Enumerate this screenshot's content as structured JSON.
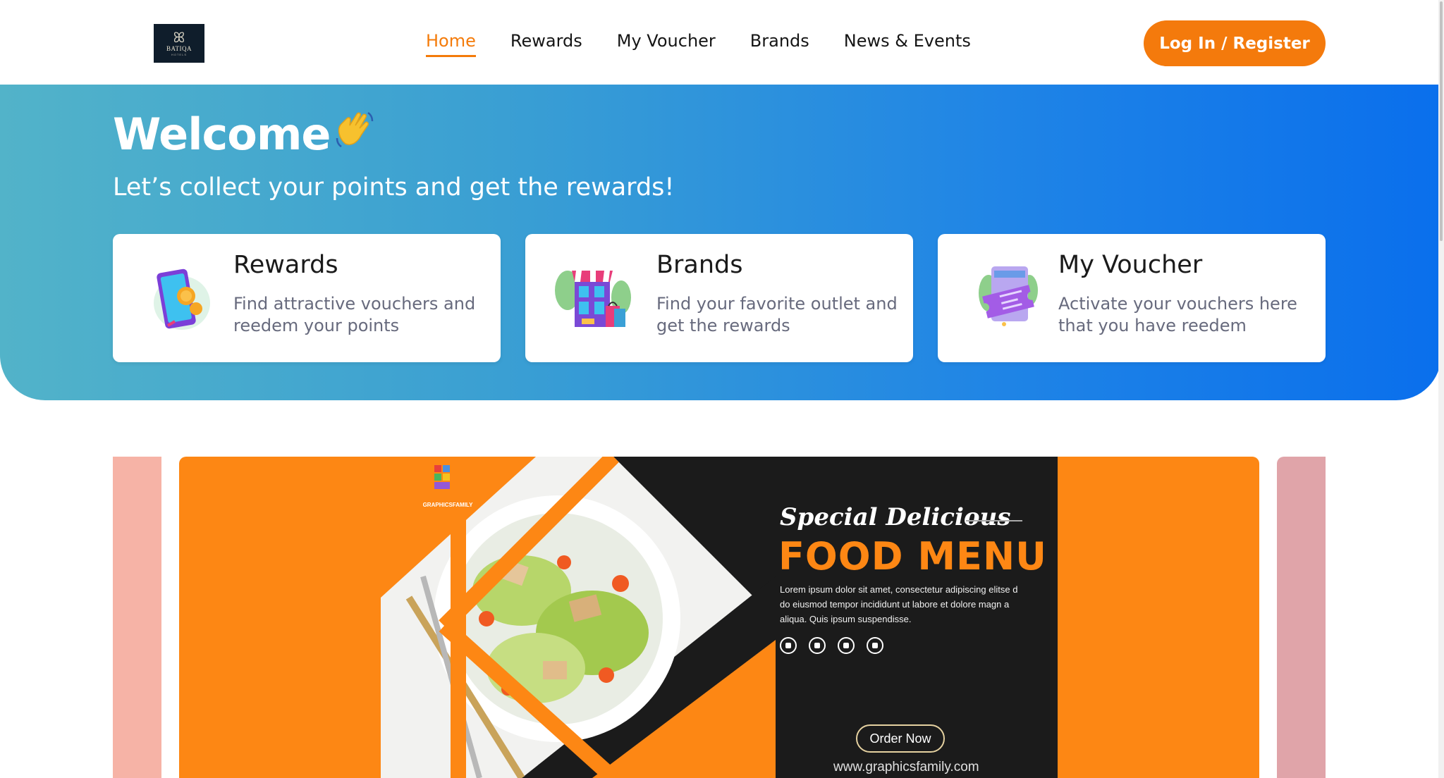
{
  "header": {
    "logo": {
      "mark": "ꕤ",
      "word": "BATIQA",
      "sub": "HOTELS"
    },
    "nav": [
      {
        "label": "Home",
        "active": true
      },
      {
        "label": "Rewards",
        "active": false
      },
      {
        "label": "My Voucher",
        "active": false
      },
      {
        "label": "Brands",
        "active": false
      },
      {
        "label": "News & Events",
        "active": false
      }
    ],
    "login_label": "Log In / Register"
  },
  "hero": {
    "title": "Welcome",
    "wave_emoji": "👋",
    "tagline": "Let’s collect your points and get the rewards!",
    "cards": [
      {
        "title": "Rewards",
        "desc": "Find attractive vouchers and reedem your points",
        "icon": "phone-coins-icon"
      },
      {
        "title": "Brands",
        "desc": "Find your favorite outlet and get the rewards",
        "icon": "store-bags-icon"
      },
      {
        "title": "My Voucher",
        "desc": "Activate your vouchers here that you have reedem",
        "icon": "voucher-ticket-icon"
      }
    ]
  },
  "banner": {
    "logo_text": "GRAPHICSFAMILY",
    "script_title": "Special Delicious",
    "main_title": "FOOD MENU",
    "body": "Lorem ipsum dolor sit amet, consectetur adipiscing elitse d do eiusmod tempor incididunt ut labore et dolore magn a aliqua. Quis ipsum suspendisse.",
    "socials": [
      "youtube-icon",
      "twitter-icon",
      "facebook-icon",
      "instagram-icon"
    ],
    "order_label": "Order Now",
    "url": "www.graphicsfamily.com"
  },
  "colors": {
    "accent": "#f47a0c",
    "hero_start": "#52b3c9",
    "hero_end": "#0a6fec",
    "slide_bg": "#fd8714"
  }
}
